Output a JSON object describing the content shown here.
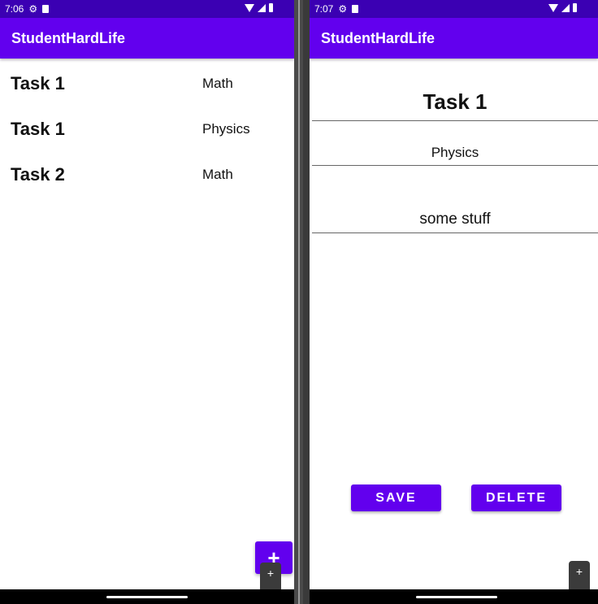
{
  "colors": {
    "status_bar": "#3b00b3",
    "app_bar": "#6200ee",
    "accent": "#6200ee"
  },
  "left_screen": {
    "status": {
      "time": "7:06"
    },
    "app_title": "StudentHardLife",
    "tasks": [
      {
        "title": "Task 1",
        "subject": "Math"
      },
      {
        "title": "Task 1",
        "subject": "Physics"
      },
      {
        "title": "Task 2",
        "subject": "Math"
      }
    ],
    "fab_icon": "plus-icon",
    "fab_label": "+",
    "zoom": {
      "plus": "+",
      "minus": "−"
    }
  },
  "right_screen": {
    "status": {
      "time": "7:07"
    },
    "app_title": "StudentHardLife",
    "detail": {
      "title": "Task 1",
      "subject": "Physics",
      "notes": "some stuff"
    },
    "save_label": "SAVE",
    "delete_label": "DELETE",
    "zoom": {
      "plus": "+",
      "minus": "−"
    }
  }
}
